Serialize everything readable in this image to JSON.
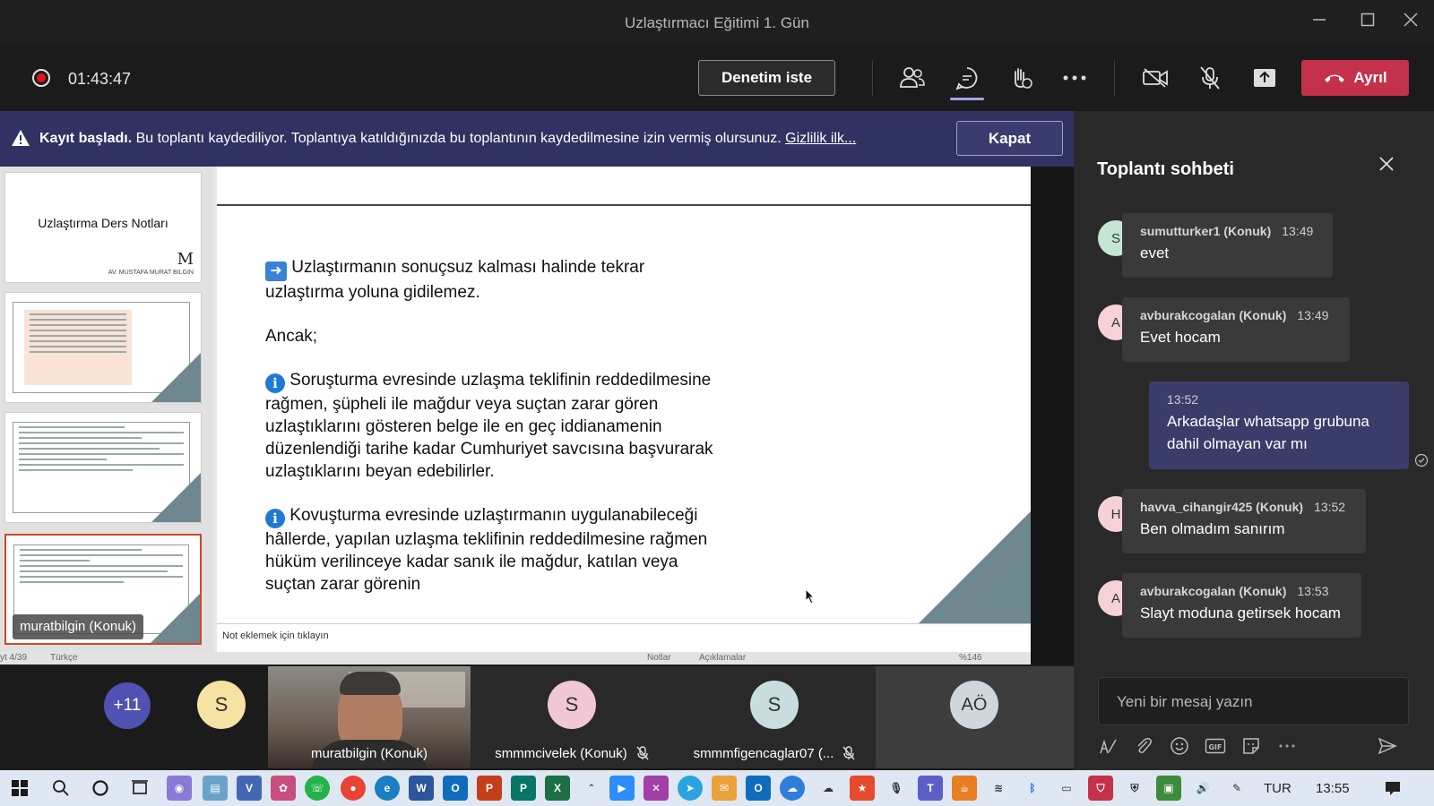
{
  "window": {
    "title": "Uzlaştırmacı Eğitimi 1. Gün"
  },
  "toolbar": {
    "timer": "01:43:47",
    "request_control": "Denetim iste",
    "leave": "Ayrıl"
  },
  "banner": {
    "bold": "Kayıt başladı.",
    "message": " Bu toplantı kaydediliyor. Toplantıya katıldığınızda bu toplantının kaydedilmesine izin vermiş olursunuz. ",
    "link": "Gizlilik ilk...",
    "dismiss": "Kapat"
  },
  "presentation": {
    "thumb1_title": "Uzlaştırma Ders Notları",
    "thumb1_logo": "AV. MUSTAFA MURAT BILGIN",
    "slide_paragraphs": [
      "Uzlaştırmanın sonuçsuz kalması halinde tekrar uzlaştırma yoluna gidilemez.",
      "Ancak;",
      "Soruşturma evresinde uzlaşma teklifinin reddedilmesine rağmen, şüpheli ile mağdur veya suçtan  zarar gören uzlaştıklarını gösteren belge ile en geç iddianamenin düzenlendiği tarihe kadar Cumhuriyet savcısına başvurarak uzlaştıklarını beyan edebilirler.",
      "Kovuşturma evresinde uzlaştırmanın uygulanabileceği hâllerde, yapılan uzlaşma teklifinin reddedilmesine rağmen hüküm verilinceye kadar sanık ile mağdur, katılan veya suçtan zarar görenin"
    ],
    "notes_placeholder": "Not eklemek için tıklayın",
    "status_left": "yt 4/39",
    "status_lang": "Türkçe",
    "status_notes": "Notlar",
    "status_comments": "Açıklamalar",
    "status_zoom": "%146",
    "presenter_tag": "muratbilgin (Konuk)"
  },
  "participants": {
    "more_count": "+11",
    "s_initial": "S",
    "video_name": "muratbilgin (Konuk)",
    "tile1_initial": "S",
    "tile1_name": "smmmcivelek (Konuk)",
    "tile2_initial": "S",
    "tile2_name": "smmmfigencaglar07 (...",
    "tile3_initial": "AÖ"
  },
  "chat": {
    "title": "Toplantı sohbeti",
    "messages": [
      {
        "initial": "S",
        "name": "sumutturker1 (Konuk)",
        "time": "13:49",
        "text": "evet"
      },
      {
        "initial": "A",
        "name": "avburakcogalan (Konuk)",
        "time": "13:49",
        "text": "Evet hocam"
      },
      {
        "time": "13:52",
        "text": "Arkadaşlar whatsapp grubuna dahil olmayan var mı"
      },
      {
        "initial": "H",
        "name": "havva_cihangir425 (Konuk)",
        "time": "13:52",
        "text": "Ben olmadım sanırım"
      },
      {
        "initial": "A",
        "name": "avburakcogalan (Konuk)",
        "time": "13:53",
        "text": "Slayt moduna getirsek hocam"
      }
    ],
    "compose_placeholder": "Yeni bir mesaj yazın"
  },
  "taskbar": {
    "lang": "TUR",
    "clock": "13:55"
  },
  "colors": {
    "accent": "#6264a7",
    "banner": "#303261",
    "leave": "#c4314b",
    "recording": "#e81123"
  }
}
